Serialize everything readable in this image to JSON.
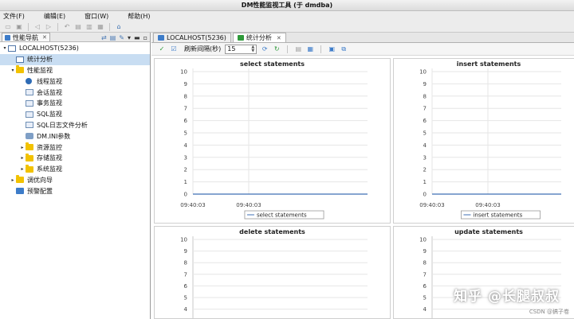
{
  "window": {
    "title": "DM性能监视工具 (于 dmdba)"
  },
  "menu": [
    "文件(F)",
    "编辑(E)",
    "窗口(W)",
    "帮助(H)"
  ],
  "nav": {
    "tab_label": "性能导航",
    "tree": [
      {
        "label": "LOCALHOST(5236)",
        "level": 0,
        "expanded": true,
        "icon": "server-icon",
        "arrow": "▾"
      },
      {
        "label": "统计分析",
        "level": 1,
        "selected": true,
        "icon": "chart-icon",
        "arrow": ""
      },
      {
        "label": "性能监视",
        "level": 1,
        "expanded": true,
        "icon": "folder-icon",
        "arrow": "▾"
      },
      {
        "label": "线程监视",
        "level": 2,
        "icon": "gear-icon",
        "arrow": ""
      },
      {
        "label": "会话监视",
        "level": 2,
        "icon": "session-icon",
        "arrow": ""
      },
      {
        "label": "事务监视",
        "level": 2,
        "icon": "transaction-icon",
        "arrow": ""
      },
      {
        "label": "SQL监视",
        "level": 2,
        "icon": "sql-icon",
        "arrow": ""
      },
      {
        "label": "SQL日志文件分析",
        "level": 2,
        "icon": "log-icon",
        "arrow": ""
      },
      {
        "label": "DM.INI参数",
        "level": 2,
        "icon": "ini-icon",
        "arrow": ""
      },
      {
        "label": "资源监控",
        "level": 2,
        "icon": "folder-icon",
        "arrow": "▸"
      },
      {
        "label": "存储监视",
        "level": 2,
        "icon": "folder-icon",
        "arrow": "▸"
      },
      {
        "label": "系统监视",
        "level": 2,
        "icon": "folder-icon",
        "arrow": "▸"
      },
      {
        "label": "调优向导",
        "level": 1,
        "icon": "folder-icon",
        "arrow": "▸"
      },
      {
        "label": "预警配置",
        "level": 1,
        "icon": "alarm-config-icon",
        "arrow": ""
      }
    ]
  },
  "editor_tabs": [
    {
      "label": "LOCALHOST(5236)",
      "active": false,
      "closable": false
    },
    {
      "label": "统计分析",
      "active": true,
      "closable": true
    }
  ],
  "stats_toolbar": {
    "interval_label": "刷新间隔(秒)",
    "interval_value": "15"
  },
  "chart_data": [
    {
      "type": "line",
      "title": "select statements",
      "x": [
        "09:40:03",
        "09:40:03"
      ],
      "series": [
        {
          "name": "select statements",
          "values": [
            0,
            0
          ]
        }
      ],
      "ylim": [
        0,
        10
      ],
      "yticks": [
        0,
        1,
        2,
        3,
        4,
        5,
        6,
        7,
        8,
        9,
        10
      ],
      "legend": "bottom",
      "grid": true,
      "line_color": "#3d6fb5"
    },
    {
      "type": "line",
      "title": "insert statements",
      "x": [
        "09:40:03",
        "09:40:03"
      ],
      "series": [
        {
          "name": "insert statements",
          "values": [
            0,
            0
          ]
        }
      ],
      "ylim": [
        0,
        10
      ],
      "yticks": [
        0,
        1,
        2,
        3,
        4,
        5,
        6,
        7,
        8,
        9,
        10
      ],
      "legend": "bottom",
      "grid": true,
      "line_color": "#3d6fb5"
    },
    {
      "type": "line",
      "title": "delete statements",
      "x": [],
      "series": [
        {
          "values": []
        }
      ],
      "ylim": [
        0,
        10
      ],
      "yticks": [
        4,
        5,
        6,
        7,
        8,
        9,
        10
      ],
      "legend": "bottom",
      "grid": true,
      "line_color": "#3d6fb5"
    },
    {
      "type": "line",
      "title": "update statements",
      "x": [],
      "series": [
        {
          "values": []
        }
      ],
      "ylim": [
        0,
        10
      ],
      "yticks": [
        4,
        5,
        6,
        7,
        8,
        9,
        10
      ],
      "legend": "bottom",
      "grid": true,
      "line_color": "#3d6fb5"
    }
  ],
  "watermark": {
    "text": "知乎 @长腿叔叔",
    "sub": "CSDN @搞子卷"
  }
}
